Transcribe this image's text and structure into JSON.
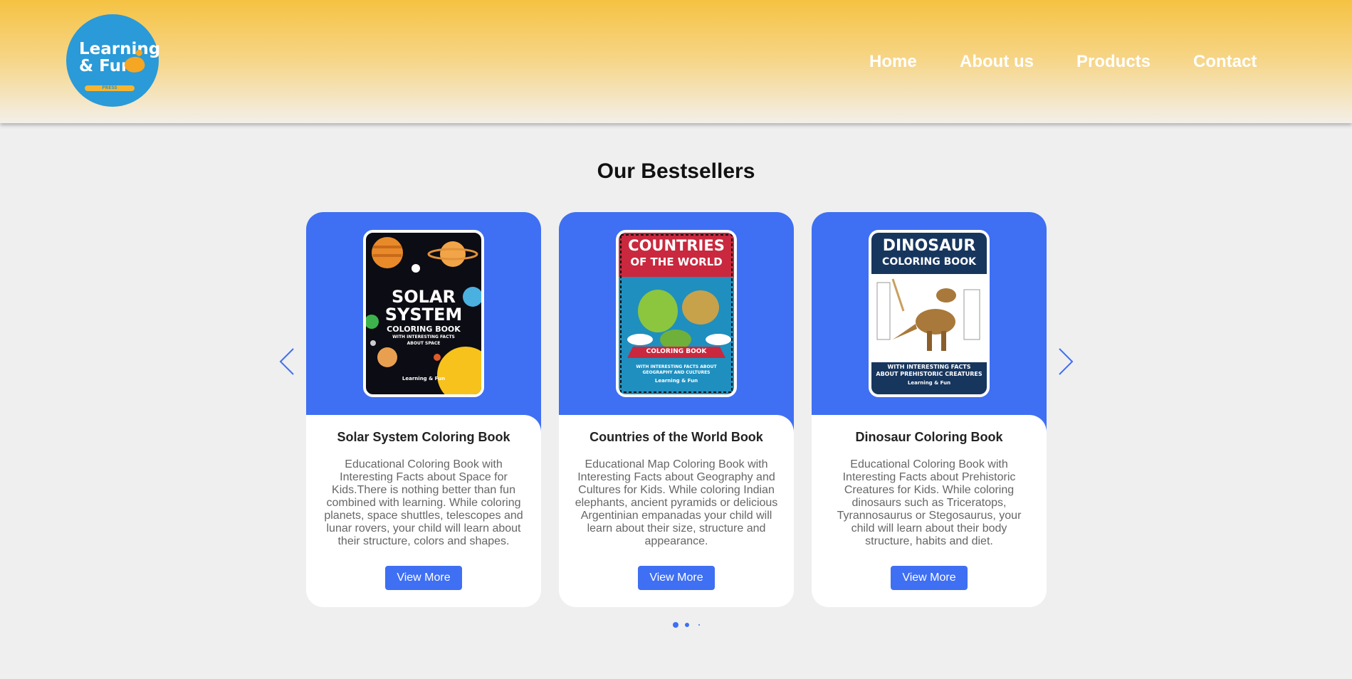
{
  "header": {
    "logo": {
      "line1": "Learning",
      "line2": "& Fun",
      "tag": "PRESS"
    },
    "nav": [
      {
        "label": "Home"
      },
      {
        "label": "About us"
      },
      {
        "label": "Products"
      },
      {
        "label": "Contact"
      }
    ]
  },
  "section": {
    "title": "Our Bestsellers",
    "prev_icon": "chevron-left-icon",
    "next_icon": "chevron-right-icon"
  },
  "cards": [
    {
      "title": "Solar System Coloring Book",
      "description": "Educational Coloring Book with Interesting Facts about Space for Kids.There is nothing better than fun combined with learning. While coloring planets, space shuttles, telescopes and lunar rovers, your child will learn about their structure, colors and shapes.",
      "button": "View More",
      "cover": {
        "line1": "SOLAR",
        "line2": "SYSTEM",
        "line3": "COLORING BOOK",
        "line4": "WITH INTERESTING FACTS",
        "line5": "ABOUT SPACE",
        "brand": "Learning & Fun"
      }
    },
    {
      "title": "Countries of the World Book",
      "description": "Educational Map Coloring Book with Interesting Facts about Geography and Cultures for Kids. While coloring Indian elephants, ancient pyramids or delicious Argentinian empanadas your child will learn about their size, structure and appearance.",
      "button": "View More",
      "cover": {
        "line1": "COUNTRIES",
        "line2": "OF THE WORLD",
        "line3": "COLORING BOOK",
        "line4": "WITH INTERESTING FACTS ABOUT GEOGRAPHY AND CULTURES",
        "brand": "Learning & Fun"
      }
    },
    {
      "title": "Dinosaur Coloring Book",
      "description": "Educational Coloring Book with Interesting Facts about Prehistoric Creatures for Kids. While coloring dinosaurs such as Triceratops, Tyrannosaurus or Stegosaurus, your child will learn about their body structure, habits and diet.",
      "button": "View More",
      "cover": {
        "line1": "DINOSAUR",
        "line2": "COLORING BOOK",
        "line3": "WITH INTERESTING FACTS ABOUT PREHISTORIC CREATURES",
        "brand": "Learning & Fun"
      }
    }
  ],
  "pagination": {
    "count": 3,
    "active": 0
  },
  "colors": {
    "accent": "#3f6ff2",
    "header_top": "#f5c242",
    "logo_bg": "#2a9ad8"
  }
}
